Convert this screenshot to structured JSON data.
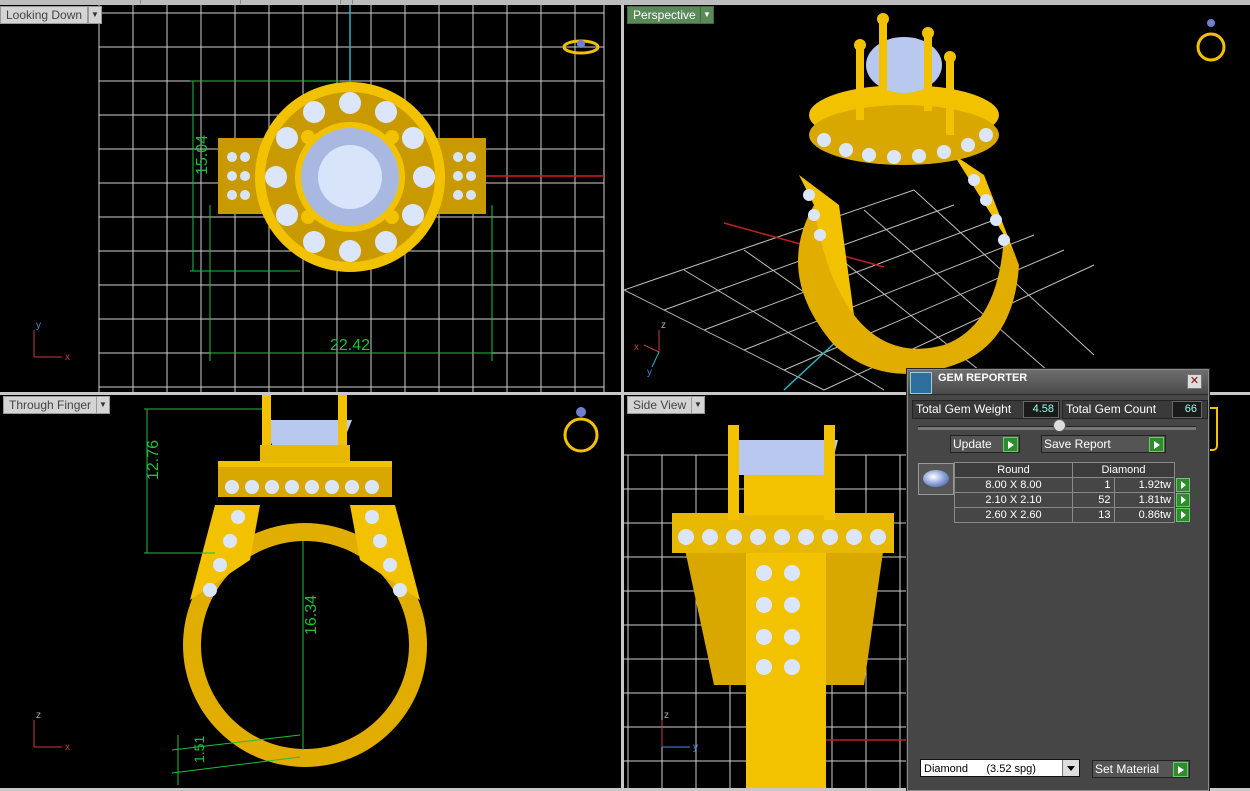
{
  "viewports": {
    "top": {
      "label": "Looking Down",
      "dim_height": "15.04",
      "dim_width": "22.42",
      "axis_y": "y",
      "axis_x": "x"
    },
    "perspective": {
      "label": "Perspective",
      "axis_z": "z",
      "axis_y": "y",
      "axis_x": "x"
    },
    "front": {
      "label": "Through Finger",
      "dim_top": "12.76",
      "dim_inner": "16.34",
      "dim_band": "1.51",
      "axis_z": "z",
      "axis_x": "x"
    },
    "side": {
      "label": "Side View",
      "axis_z": "z",
      "axis_y": "y"
    }
  },
  "gem_reporter": {
    "title": "GEM REPORTER",
    "total_weight_label": "Total Gem Weight",
    "total_weight_value": "4.58",
    "total_count_label": "Total Gem Count",
    "total_count_value": "66",
    "update_label": "Update",
    "save_report_label": "Save Report",
    "table": {
      "col_shape": "Round",
      "col_material": "Diamond",
      "rows": [
        {
          "size": "8.00 X 8.00",
          "count": "1",
          "weight": "1.92tw"
        },
        {
          "size": "2.10 X 2.10",
          "count": "52",
          "weight": "1.81tw"
        },
        {
          "size": "2.60 X 2.60",
          "count": "13",
          "weight": "0.86tw"
        }
      ]
    },
    "material_select": "Diamond      (3.52 spg)",
    "set_material_label": "Set Material"
  },
  "colors": {
    "gold": "#f2c200",
    "grid": "#cfcfcf",
    "dimension": "#1fbf3f",
    "stone": "#c8d8f4"
  }
}
